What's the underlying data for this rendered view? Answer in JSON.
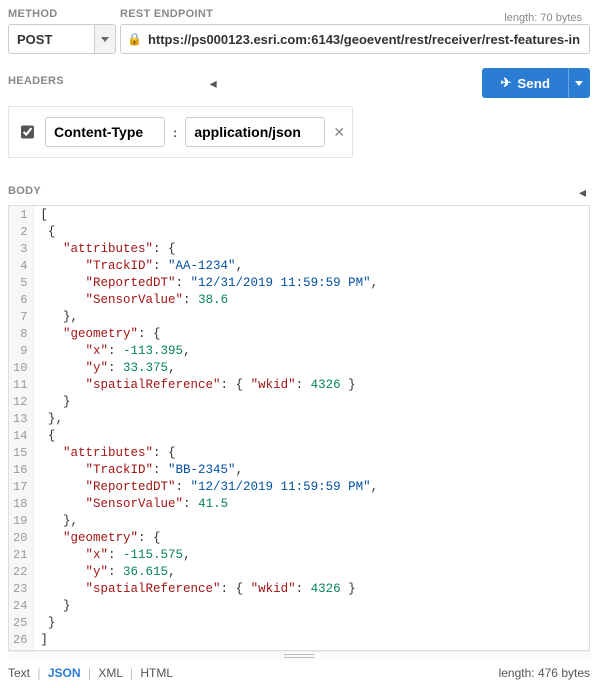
{
  "labels": {
    "method": "METHOD",
    "endpoint": "REST ENDPOINT",
    "headers": "HEADERS",
    "body": "BODY"
  },
  "method": {
    "value": "POST"
  },
  "endpoint": {
    "url": "https://ps000123.esri.com:6143/geoevent/rest/receiver/rest-features-in",
    "length_label": "length: 70 bytes"
  },
  "send": {
    "label": "Send"
  },
  "header_row": {
    "enabled": true,
    "name": "Content-Type",
    "value": "application/json"
  },
  "body": {
    "length_label": "length: 476 bytes",
    "raw": "[\n {\n   \"attributes\": {\n      \"TrackID\": \"AA-1234\",\n      \"ReportedDT\": \"12/31/2019 11:59:59 PM\",\n      \"SensorValue\": 38.6\n   },\n   \"geometry\": {\n      \"x\": -113.395,\n      \"y\": 33.375,\n      \"spatialReference\": { \"wkid\": 4326 }\n   }\n },\n {\n   \"attributes\": {\n      \"TrackID\": \"BB-2345\",\n      \"ReportedDT\": \"12/31/2019 11:59:59 PM\",\n      \"SensorValue\": 41.5\n   },\n   \"geometry\": {\n      \"x\": -115.575,\n      \"y\": 36.615,\n      \"spatialReference\": { \"wkid\": 4326 }\n   }\n }\n]"
  },
  "format_tabs": {
    "text": "Text",
    "json": "JSON",
    "xml": "XML",
    "html": "HTML"
  }
}
